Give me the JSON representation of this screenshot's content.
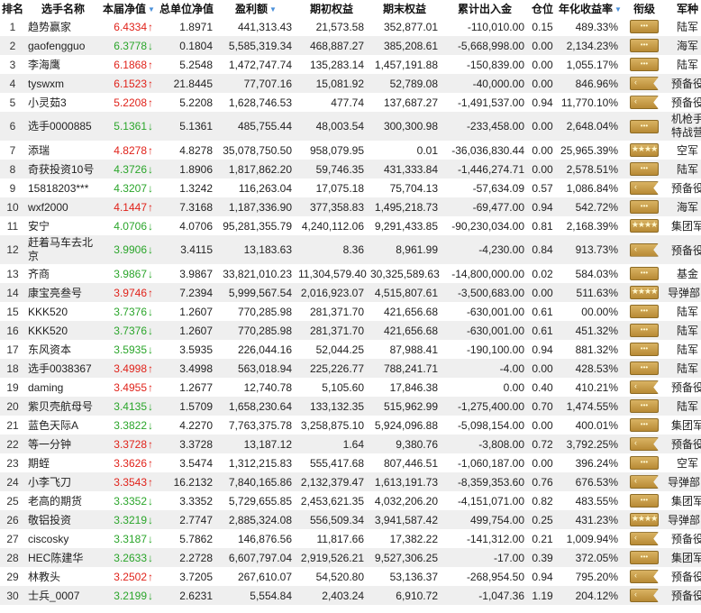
{
  "headers": {
    "rank": "排名",
    "name": "选手名称",
    "nav": "本届净值",
    "unit_nav": "总单位净值",
    "profit": "盈利额",
    "start_equity": "期初权益",
    "end_equity": "期末权益",
    "net_flow": "累计出入金",
    "position": "仓位",
    "annual_rate": "年化收益率",
    "title": "衔级",
    "army": "军种"
  },
  "sort_arrow": "▼",
  "colors": {
    "up": "#e0221a",
    "down": "#2aa52a",
    "badge_gold": "#c99b45",
    "row_alt": "#efefef"
  },
  "rows": [
    {
      "rank": "1",
      "name": "趋势赢家",
      "nav": "6.4334",
      "dir": "up",
      "unit": "1.8971",
      "profit": "441,313.43",
      "start": "21,573.58",
      "end": "352,877.01",
      "flow": "-110,010.00",
      "pos": "0.15",
      "rate": "489.33%",
      "badge": "bar",
      "army": "陆军"
    },
    {
      "rank": "2",
      "name": "gaofengguo",
      "nav": "6.3778",
      "dir": "down",
      "unit": "0.1804",
      "profit": "5,585,319.34",
      "start": "468,887.27",
      "end": "385,208.61",
      "flow": "-5,668,998.00",
      "pos": "0.00",
      "rate": "2,134.23%",
      "badge": "bar",
      "army": "海军"
    },
    {
      "rank": "3",
      "name": "李海鹰",
      "nav": "6.1868",
      "dir": "up",
      "unit": "5.2548",
      "profit": "1,472,747.74",
      "start": "135,283.14",
      "end": "1,457,191.88",
      "flow": "-150,839.00",
      "pos": "0.00",
      "rate": "1,055.17%",
      "badge": "bar",
      "army": "陆军"
    },
    {
      "rank": "4",
      "name": "tyswxm",
      "nav": "6.1523",
      "dir": "up",
      "unit": "21.8445",
      "profit": "77,707.16",
      "start": "15,081.92",
      "end": "52,789.08",
      "flow": "-40,000.00",
      "pos": "0.00",
      "rate": "846.96%",
      "badge": "flag",
      "army": "预备役"
    },
    {
      "rank": "5",
      "name": "小灵茹3",
      "nav": "5.2208",
      "dir": "up",
      "unit": "5.2208",
      "profit": "1,628,746.53",
      "start": "477.74",
      "end": "137,687.27",
      "flow": "-1,491,537.00",
      "pos": "0.94",
      "rate": "11,770.10%",
      "badge": "flag",
      "army": "预备役"
    },
    {
      "rank": "6",
      "name": "选手0000885",
      "nav": "5.1361",
      "dir": "down",
      "unit": "5.1361",
      "profit": "485,755.44",
      "start": "48,003.54",
      "end": "300,300.98",
      "flow": "-233,458.00",
      "pos": "0.00",
      "rate": "2,648.04%",
      "badge": "bar",
      "army": "机枪手特战营",
      "tall": true
    },
    {
      "rank": "7",
      "name": "添瑞",
      "nav": "4.8278",
      "dir": "up",
      "unit": "4.8278",
      "profit": "35,078,750.50",
      "start": "958,079.95",
      "end": "0.01",
      "flow": "-36,036,830.44",
      "pos": "0.00",
      "rate": "25,965.39%",
      "badge": "chev",
      "army": "空军"
    },
    {
      "rank": "8",
      "name": "奇获投资10号",
      "nav": "4.3726",
      "dir": "down",
      "unit": "1.8906",
      "profit": "1,817,862.20",
      "start": "59,746.35",
      "end": "431,333.84",
      "flow": "-1,446,274.71",
      "pos": "0.00",
      "rate": "2,578.51%",
      "badge": "bar",
      "army": "陆军"
    },
    {
      "rank": "9",
      "name": "15818203***",
      "nav": "4.3207",
      "dir": "down",
      "unit": "1.3242",
      "profit": "116,263.04",
      "start": "17,075.18",
      "end": "75,704.13",
      "flow": "-57,634.09",
      "pos": "0.57",
      "rate": "1,086.84%",
      "badge": "flag",
      "army": "预备役"
    },
    {
      "rank": "10",
      "name": "wxf2000",
      "nav": "4.1447",
      "dir": "up",
      "unit": "7.3168",
      "profit": "1,187,336.90",
      "start": "377,358.83",
      "end": "1,495,218.73",
      "flow": "-69,477.00",
      "pos": "0.94",
      "rate": "542.72%",
      "badge": "bar",
      "army": "海军"
    },
    {
      "rank": "11",
      "name": "安宁",
      "nav": "4.0706",
      "dir": "down",
      "unit": "4.0706",
      "profit": "95,281,355.79",
      "start": "4,240,112.06",
      "end": "9,291,433.85",
      "flow": "-90,230,034.00",
      "pos": "0.81",
      "rate": "2,168.39%",
      "badge": "chev",
      "army": "集团军"
    },
    {
      "rank": "12",
      "name": "赶着马车去北京",
      "nav": "3.9906",
      "dir": "down",
      "unit": "3.4115",
      "profit": "13,183.63",
      "start": "8.36",
      "end": "8,961.99",
      "flow": "-4,230.00",
      "pos": "0.84",
      "rate": "913.73%",
      "badge": "flag",
      "army": "预备役",
      "tall": true
    },
    {
      "rank": "13",
      "name": "齐商",
      "nav": "3.9867",
      "dir": "down",
      "unit": "3.9867",
      "profit": "33,821,010.23",
      "start": "11,304,579.40",
      "end": "30,325,589.63",
      "flow": "-14,800,000.00",
      "pos": "0.02",
      "rate": "584.03%",
      "badge": "bar",
      "army": "基金"
    },
    {
      "rank": "14",
      "name": "康宝亮叁号",
      "nav": "3.9746",
      "dir": "up",
      "unit": "7.2394",
      "profit": "5,999,567.54",
      "start": "2,016,923.07",
      "end": "4,515,807.61",
      "flow": "-3,500,683.00",
      "pos": "0.00",
      "rate": "511.63%",
      "badge": "chev",
      "army": "导弹部队"
    },
    {
      "rank": "15",
      "name": "KKK520",
      "nav": "3.7376",
      "dir": "down",
      "unit": "1.2607",
      "profit": "770,285.98",
      "start": "281,371.70",
      "end": "421,656.68",
      "flow": "-630,001.00",
      "pos": "0.61",
      "rate": "00.00%",
      "badge": "bar",
      "army": "陆军"
    },
    {
      "rank": "16",
      "name": "KKK520",
      "nav": "3.7376",
      "dir": "down",
      "unit": "1.2607",
      "profit": "770,285.98",
      "start": "281,371.70",
      "end": "421,656.68",
      "flow": "-630,001.00",
      "pos": "0.61",
      "rate": "451.32%",
      "badge": "bar",
      "army": "陆军"
    },
    {
      "rank": "17",
      "name": "东风资本",
      "nav": "3.5935",
      "dir": "down",
      "unit": "3.5935",
      "profit": "226,044.16",
      "start": "52,044.25",
      "end": "87,988.41",
      "flow": "-190,100.00",
      "pos": "0.94",
      "rate": "881.32%",
      "badge": "bar",
      "army": "陆军"
    },
    {
      "rank": "18",
      "name": "选手0038367",
      "nav": "3.4998",
      "dir": "up",
      "unit": "3.4998",
      "profit": "563,018.94",
      "start": "225,226.77",
      "end": "788,241.71",
      "flow": "-4.00",
      "pos": "0.00",
      "rate": "428.53%",
      "badge": "bar",
      "army": "陆军"
    },
    {
      "rank": "19",
      "name": "daming",
      "nav": "3.4955",
      "dir": "up",
      "unit": "1.2677",
      "profit": "12,740.78",
      "start": "5,105.60",
      "end": "17,846.38",
      "flow": "0.00",
      "pos": "0.40",
      "rate": "410.21%",
      "badge": "flag",
      "army": "预备役"
    },
    {
      "rank": "20",
      "name": "紫贝壳航母号",
      "nav": "3.4135",
      "dir": "down",
      "unit": "1.5709",
      "profit": "1,658,230.64",
      "start": "133,132.35",
      "end": "515,962.99",
      "flow": "-1,275,400.00",
      "pos": "0.70",
      "rate": "1,474.55%",
      "badge": "bar",
      "army": "陆军"
    },
    {
      "rank": "21",
      "name": "蓝色天际A",
      "nav": "3.3822",
      "dir": "down",
      "unit": "4.2270",
      "profit": "7,763,375.78",
      "start": "3,258,875.10",
      "end": "5,924,096.88",
      "flow": "-5,098,154.00",
      "pos": "0.00",
      "rate": "400.01%",
      "badge": "bar",
      "army": "集团军"
    },
    {
      "rank": "22",
      "name": "等一分钟",
      "nav": "3.3728",
      "dir": "up",
      "unit": "3.3728",
      "profit": "13,187.12",
      "start": "1.64",
      "end": "9,380.76",
      "flow": "-3,808.00",
      "pos": "0.72",
      "rate": "3,792.25%",
      "badge": "flag",
      "army": "预备役"
    },
    {
      "rank": "23",
      "name": "期蛭",
      "nav": "3.3626",
      "dir": "up",
      "unit": "3.5474",
      "profit": "1,312,215.83",
      "start": "555,417.68",
      "end": "807,446.51",
      "flow": "-1,060,187.00",
      "pos": "0.00",
      "rate": "396.24%",
      "badge": "bar",
      "army": "空军"
    },
    {
      "rank": "24",
      "name": "小李飞刀",
      "nav": "3.3543",
      "dir": "up",
      "unit": "16.2132",
      "profit": "7,840,165.86",
      "start": "2,132,379.47",
      "end": "1,613,191.73",
      "flow": "-8,359,353.60",
      "pos": "0.76",
      "rate": "676.53%",
      "badge": "flag",
      "army": "导弹部队"
    },
    {
      "rank": "25",
      "name": "老高的期货",
      "nav": "3.3352",
      "dir": "down",
      "unit": "3.3352",
      "profit": "5,729,655.85",
      "start": "2,453,621.35",
      "end": "4,032,206.20",
      "flow": "-4,151,071.00",
      "pos": "0.82",
      "rate": "483.55%",
      "badge": "bar",
      "army": "集团军"
    },
    {
      "rank": "26",
      "name": "敬铝投资",
      "nav": "3.3219",
      "dir": "down",
      "unit": "2.7747",
      "profit": "2,885,324.08",
      "start": "556,509.34",
      "end": "3,941,587.42",
      "flow": "499,754.00",
      "pos": "0.25",
      "rate": "431.23%",
      "badge": "chev",
      "army": "导弹部队"
    },
    {
      "rank": "27",
      "name": "ciscosky",
      "nav": "3.3187",
      "dir": "down",
      "unit": "5.7862",
      "profit": "146,876.56",
      "start": "11,817.66",
      "end": "17,382.22",
      "flow": "-141,312.00",
      "pos": "0.21",
      "rate": "1,009.94%",
      "badge": "flag",
      "army": "预备役"
    },
    {
      "rank": "28",
      "name": "HEC陈建华",
      "nav": "3.2633",
      "dir": "down",
      "unit": "2.2728",
      "profit": "6,607,797.04",
      "start": "2,919,526.21",
      "end": "9,527,306.25",
      "flow": "-17.00",
      "pos": "0.39",
      "rate": "372.05%",
      "badge": "bar",
      "army": "集团军"
    },
    {
      "rank": "29",
      "name": "林教头",
      "nav": "3.2502",
      "dir": "up",
      "unit": "3.7205",
      "profit": "267,610.07",
      "start": "54,520.80",
      "end": "53,136.37",
      "flow": "-268,954.50",
      "pos": "0.94",
      "rate": "795.20%",
      "badge": "flag",
      "army": "预备役"
    },
    {
      "rank": "30",
      "name": "士兵_0007",
      "nav": "3.2199",
      "dir": "down",
      "unit": "2.6231",
      "profit": "5,554.84",
      "start": "2,403.24",
      "end": "6,910.72",
      "flow": "-1,047.36",
      "pos": "1.19",
      "rate": "204.12%",
      "badge": "flag",
      "army": "预备役"
    }
  ]
}
